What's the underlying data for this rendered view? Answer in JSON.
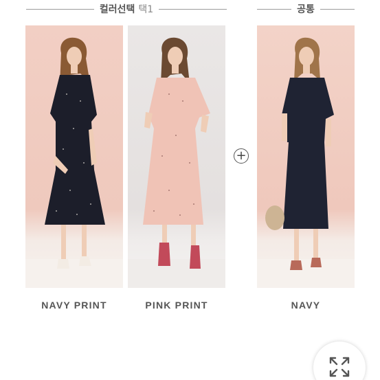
{
  "header": {
    "left_title": "컬러선택",
    "left_suffix": "택1",
    "right_title": "공통"
  },
  "products": [
    {
      "caption": "NAVY PRINT",
      "dress_color": "#1c1e2a",
      "background": "#f2cfc4"
    },
    {
      "caption": "PINK PRINT",
      "dress_color": "#f0c3b6",
      "background": "#e8e4e3"
    },
    {
      "caption": "NAVY",
      "dress_color": "#1f2333",
      "background": "#f3d3c8"
    }
  ],
  "plus_symbol": "+",
  "icons": {
    "plus": "plus-circle-icon",
    "expand": "expand-arrows-icon"
  }
}
